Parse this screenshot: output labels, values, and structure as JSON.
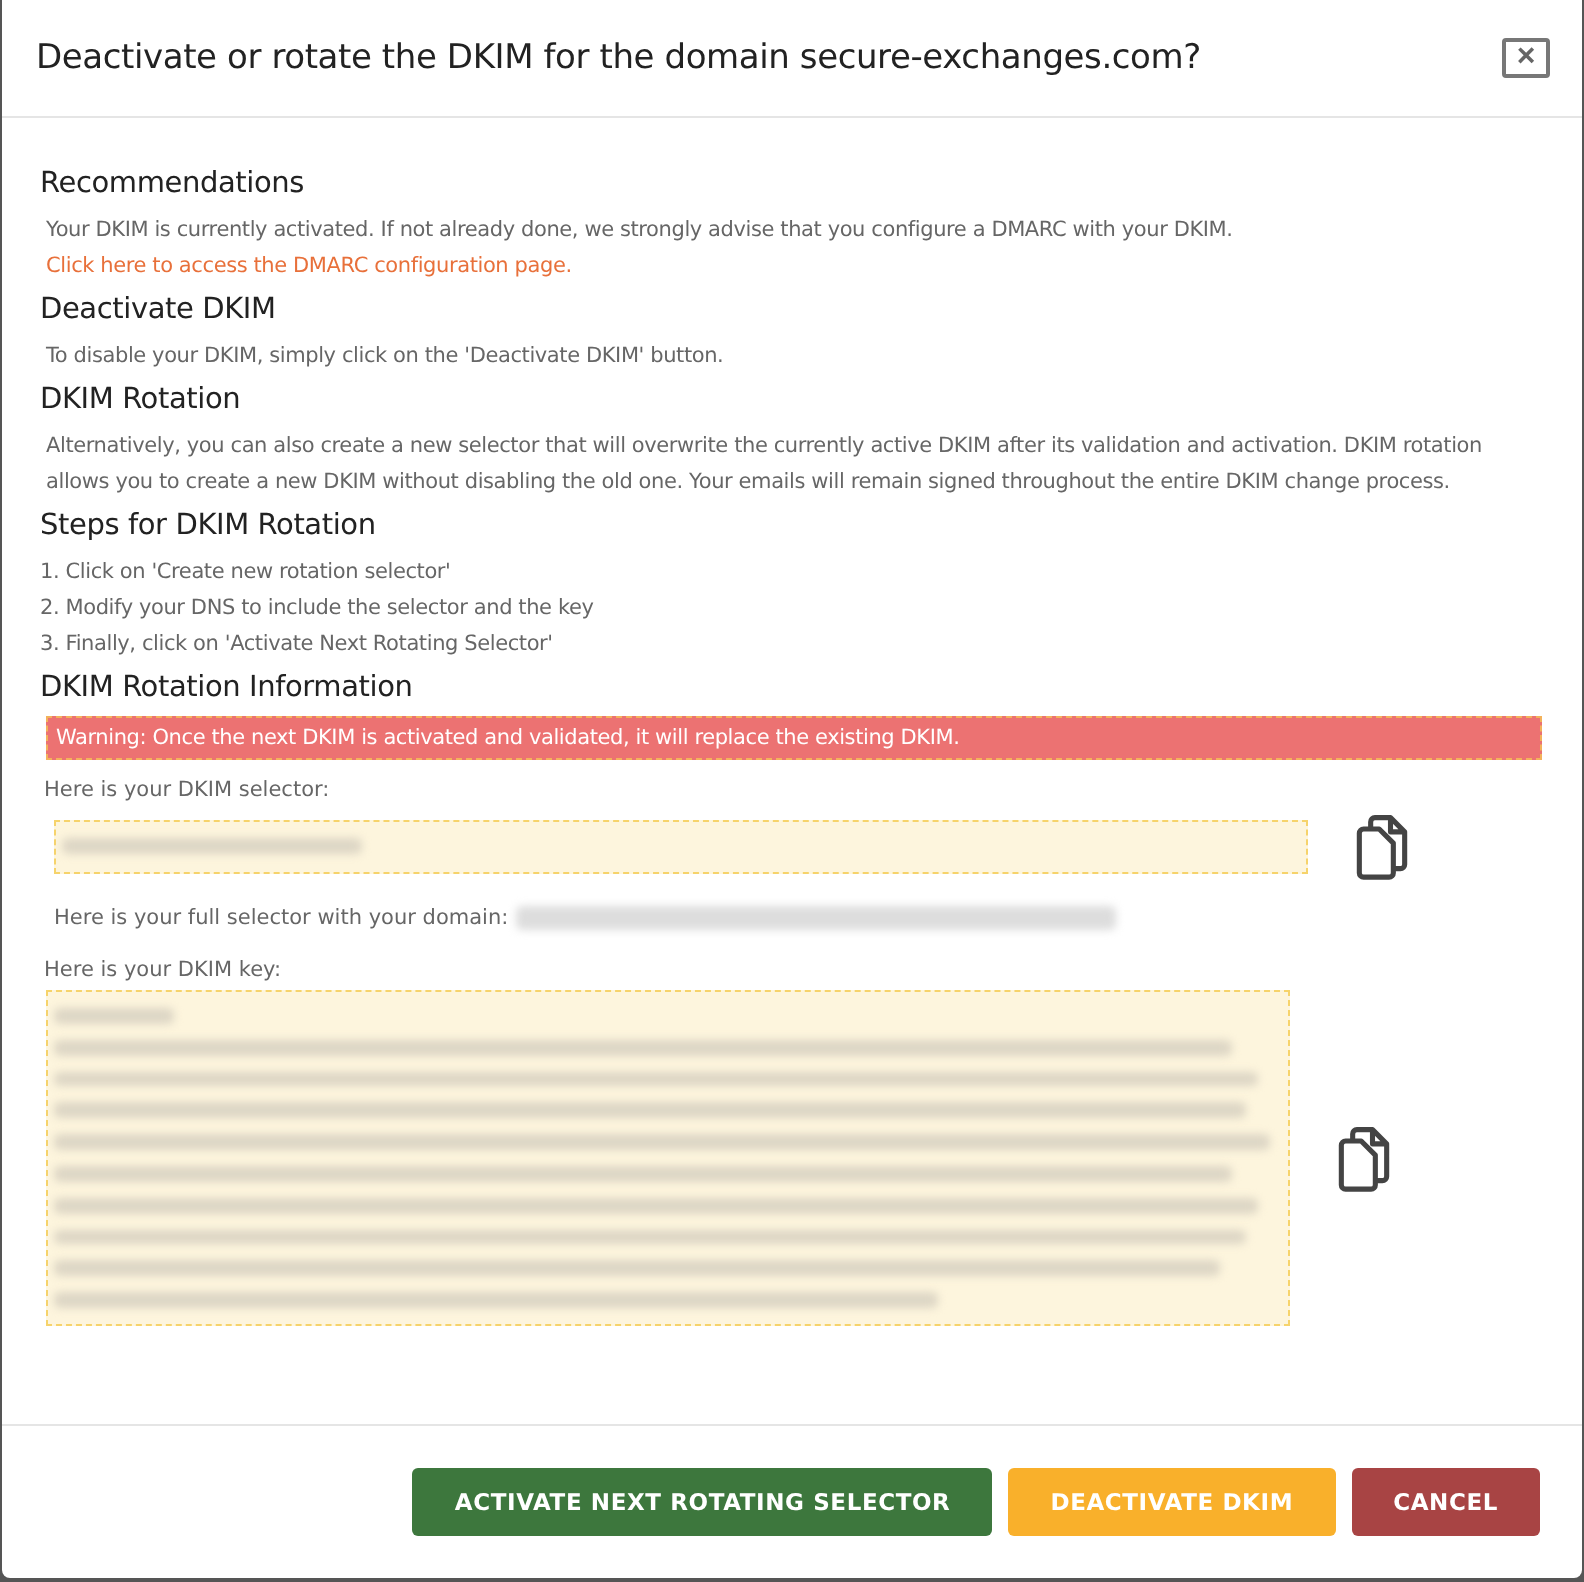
{
  "dialog": {
    "title": "Deactivate or rotate the DKIM for the domain secure-exchanges.com?",
    "close": "×"
  },
  "sections": [
    {
      "heading": "Recommendations",
      "text": "Your DKIM is currently activated. If not already done, we strongly advise that you configure a DMARC with your DKIM.",
      "link": "Click here to access the DMARC configuration page."
    },
    {
      "heading": "Deactivate DKIM",
      "text": "To disable your DKIM, simply click on the 'Deactivate DKIM' button."
    },
    {
      "heading": "DKIM Rotation",
      "text": "Alternatively, you can also create a new selector that will overwrite the currently active DKIM after its validation and activation. DKIM rotation allows you to create a new DKIM without disabling the old one. Your emails will remain signed throughout the entire DKIM change process."
    },
    {
      "heading": "Steps for DKIM Rotation",
      "steps": [
        "1. Click on 'Create new rotation selector'",
        "2. Modify your DNS to include the selector and the key",
        "3. Finally, click on 'Activate Next Rotating Selector'"
      ]
    }
  ],
  "info": {
    "heading": "DKIM Rotation Information",
    "warning": "Warning: Once the next DKIM is activated and validated, it will replace the existing DKIM.",
    "selector_label": "Here is your DKIM selector:",
    "full_selector_label": "Here is your full selector with your domain:",
    "key_label": "Here is your DKIM key:"
  },
  "buttons": [
    {
      "label": "ACTIVATE NEXT ROTATING SELECTOR",
      "kind": "primary"
    },
    {
      "label": "DEACTIVATE DKIM",
      "kind": "warning"
    },
    {
      "label": "CANCEL",
      "kind": "danger"
    }
  ]
}
